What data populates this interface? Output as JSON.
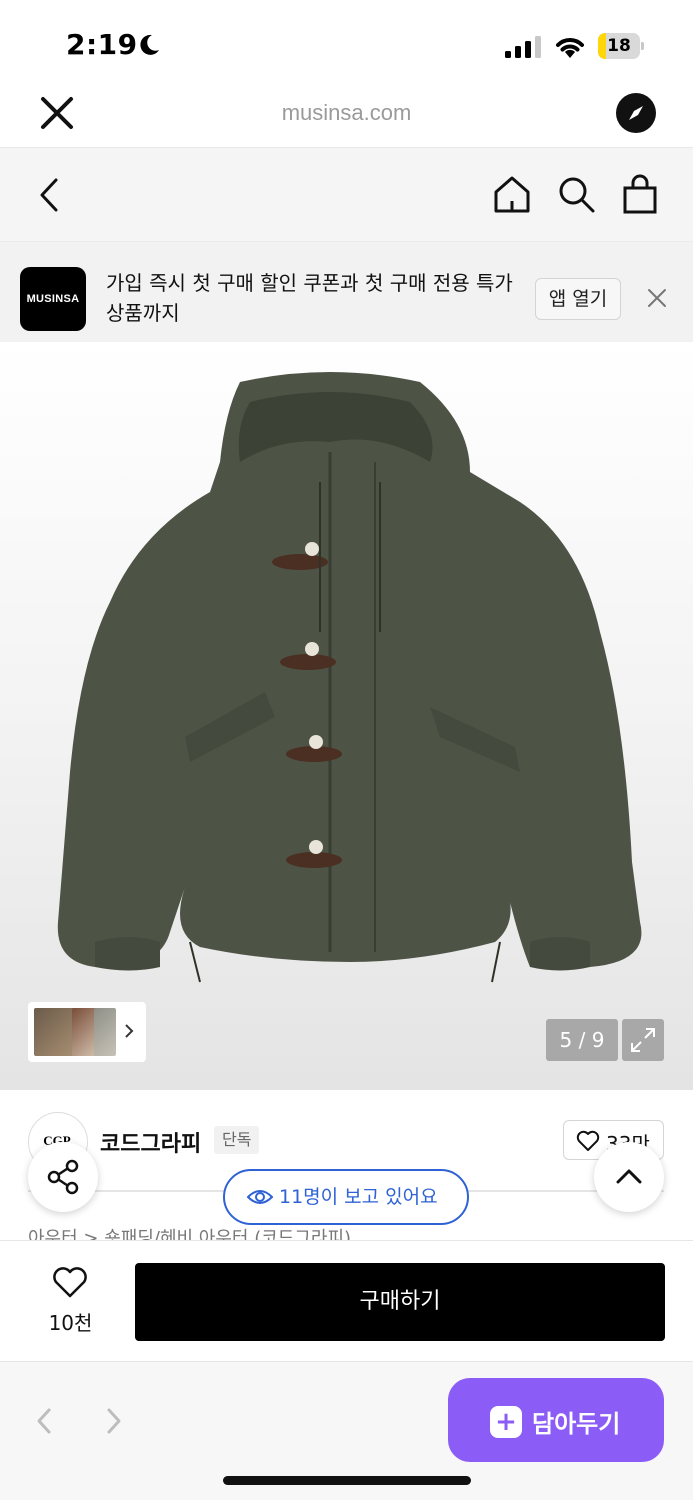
{
  "status_bar": {
    "time": "2:19",
    "battery": "18",
    "battery_level": 0.18,
    "battery_color": "#ffd60a"
  },
  "browser": {
    "url": "musinsa.com"
  },
  "app_banner": {
    "logo_text": "MUSINSA",
    "message": "가입 즉시 첫 구매 할인 쿠폰과 첫 구매 전용 특가 상품까지",
    "open_button": "앱 열기"
  },
  "gallery": {
    "counter": "5 / 9"
  },
  "brand": {
    "logo_text": "CGP.",
    "name": "코드그라피",
    "tag": "단독",
    "like_count": "33만"
  },
  "breadcrumb": "아우터  >  숏패딩/헤비 아우터 (코드그라피)",
  "viewers": {
    "text": "11명이 보고 있어요",
    "color": "#2f62d5"
  },
  "bottom_bar": {
    "wish_count": "10천",
    "buy_label": "구매하기"
  },
  "browser_bottom": {
    "save_label": "담아두기",
    "save_color": "#8b5cf6"
  },
  "icons": [
    "moon-icon",
    "signal-icon",
    "wifi-icon",
    "battery-icon",
    "close-icon",
    "compass-icon",
    "back-icon",
    "home-icon",
    "search-icon",
    "bag-icon",
    "expand-icon",
    "heart-icon",
    "share-icon",
    "chevron-up-icon",
    "eye-icon",
    "plus-icon"
  ]
}
